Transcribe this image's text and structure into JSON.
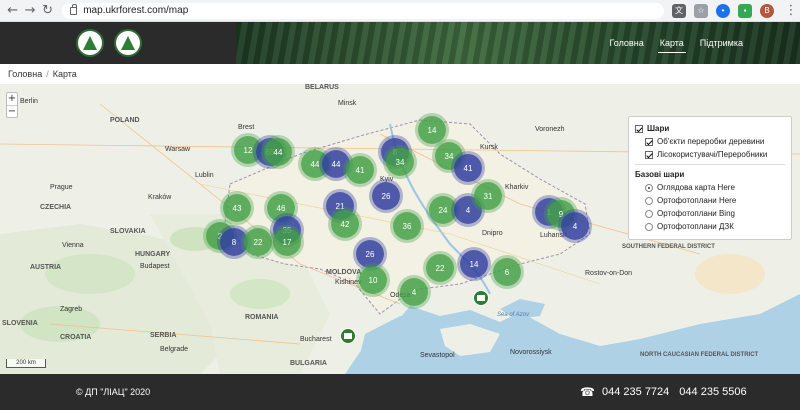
{
  "browser": {
    "url": "map.ukrforest.com/map",
    "avatar_letter": "B"
  },
  "header": {
    "nav": [
      {
        "label": "Головна",
        "active": false
      },
      {
        "label": "Карта",
        "active": true
      },
      {
        "label": "Підтримка",
        "active": false
      }
    ]
  },
  "breadcrumb": {
    "home": "Головна",
    "separator": "/",
    "current": "Карта"
  },
  "map": {
    "zoom_in": "+",
    "zoom_out": "−",
    "scale": "200 km",
    "clusters": [
      {
        "label": "12",
        "color": "green"
      },
      {
        "label": "65",
        "color": "blue"
      },
      {
        "label": "44",
        "color": "green"
      },
      {
        "label": "44",
        "color": "blue"
      },
      {
        "label": "41",
        "color": "green"
      },
      {
        "label": "14",
        "color": "green"
      },
      {
        "label": "8",
        "color": "blue"
      },
      {
        "label": "34",
        "color": "green"
      },
      {
        "label": "34",
        "color": "green"
      },
      {
        "label": "41",
        "color": "blue"
      },
      {
        "label": "26",
        "color": "blue"
      },
      {
        "label": "43",
        "color": "green"
      },
      {
        "label": "46",
        "color": "green"
      },
      {
        "label": "21",
        "color": "blue"
      },
      {
        "label": "42",
        "color": "green"
      },
      {
        "label": "36",
        "color": "green"
      },
      {
        "label": "24",
        "color": "green"
      },
      {
        "label": "4",
        "color": "blue"
      },
      {
        "label": "31",
        "color": "green"
      },
      {
        "label": "1",
        "color": "blue"
      },
      {
        "label": "9",
        "color": "green"
      },
      {
        "label": "4",
        "color": "blue"
      },
      {
        "label": "2",
        "color": "green"
      },
      {
        "label": "8",
        "color": "blue"
      },
      {
        "label": "22",
        "color": "green"
      },
      {
        "label": "35",
        "color": "blue"
      },
      {
        "label": "17",
        "color": "green"
      },
      {
        "label": "26",
        "color": "blue"
      },
      {
        "label": "10",
        "color": "green"
      },
      {
        "label": "22",
        "color": "green"
      },
      {
        "label": "14",
        "color": "blue"
      },
      {
        "label": "6",
        "color": "green"
      },
      {
        "label": "4",
        "color": "green"
      }
    ],
    "labels": [
      "Berlin",
      "POLAND",
      "BELARUS",
      "Minsk",
      "Warsaw",
      "CZECHIA",
      "SLOVAKIA",
      "AUSTRIA",
      "HUNGARY",
      "Budapest",
      "ROMANIA",
      "MOLDOVA",
      "Kishinev",
      "SERBIA",
      "Belgrade",
      "BULGARIA",
      "Bucharest",
      "Kyiv",
      "Dnipro",
      "Kharkiv",
      "Voronezh",
      "Odesa",
      "Sea of Azov",
      "Rostov-on-Don",
      "SOUTHERN FEDERAL DISTRICT",
      "NORTH CAUCASIAN FEDERAL DISTRICT",
      "Sevastopol",
      "Novorossiysk",
      "Kraków",
      "Vienna",
      "Prague",
      "Lublin",
      "Brest",
      "Kursk",
      "Luhansk",
      "SLOVENIA",
      "CROATIA",
      "Zagreb"
    ]
  },
  "layers_panel": {
    "group_title": "Шари",
    "overlays": [
      {
        "label": "Об'єкти переробки деревини",
        "checked": true
      },
      {
        "label": "Лісокористувачі/Переробники",
        "checked": true
      }
    ],
    "base_title": "Базові шари",
    "base_layers": [
      {
        "label": "Оглядова карта Here",
        "selected": true
      },
      {
        "label": "Ортофотоплани Here",
        "selected": false
      },
      {
        "label": "Ортофотоплани Bing",
        "selected": false
      },
      {
        "label": "Ортофотоплани ДЗК",
        "selected": false
      }
    ]
  },
  "footer": {
    "copyright": "© ДП \"ЛІАЦ\" 2020",
    "phone_1": "044 235 7724",
    "phone_2": "044 235 5506"
  }
}
